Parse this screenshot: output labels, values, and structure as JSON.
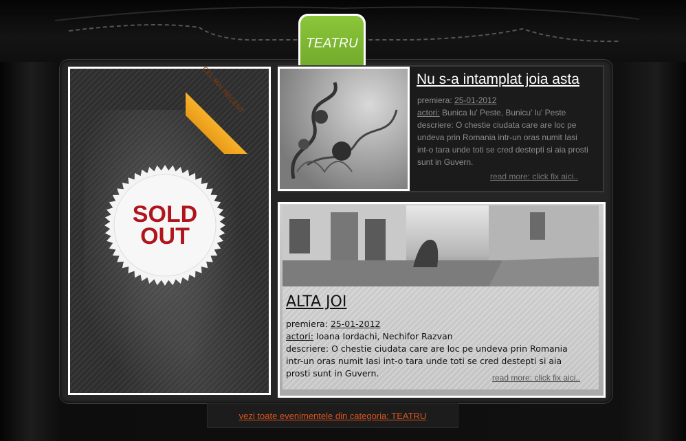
{
  "category_badge": "TEATRU",
  "featured": {
    "ribbon": "CEL MAI RECENT",
    "sold_line1": "SOLD",
    "sold_line2": "OUT"
  },
  "events": [
    {
      "title": "Nu s-a intamplat joia asta",
      "premiere_label": "premiera:",
      "premiere_date": "25-01-2012",
      "actors_label": "actori:",
      "actors": "Bunica lu' Peste, Bunicu' lu' Peste",
      "description_label": "descriere:",
      "description": "O chestie ciudata care are loc pe undeva prin Romania intr-un oras numit Iasi int-o tara unde toti se cred destepti si aia prosti sunt in Guvern.",
      "read_more": "read more: click fix aici.."
    },
    {
      "title": "ALTA JOI",
      "premiere_label": "premiera:",
      "premiere_date": "25-01-2012",
      "actors_label": "actori:",
      "actors": "Ioana Iordachi, Nechifor Razvan",
      "description_label": "descriere:",
      "description": "O chestie ciudata care are loc pe undeva prin Romania intr-un oras numit Iasi int-o tara unde toti se cred destepti si aia prosti sunt in Guvern.",
      "read_more": "read more: click fix aici.."
    }
  ],
  "footer_link": "vezi toate evenimentele din categoria: TEATRU",
  "colors": {
    "badge_green": "#7bb531",
    "ribbon_orange": "#f2a21f",
    "sold_red": "#b0151e",
    "footer_link": "#d9541d"
  }
}
